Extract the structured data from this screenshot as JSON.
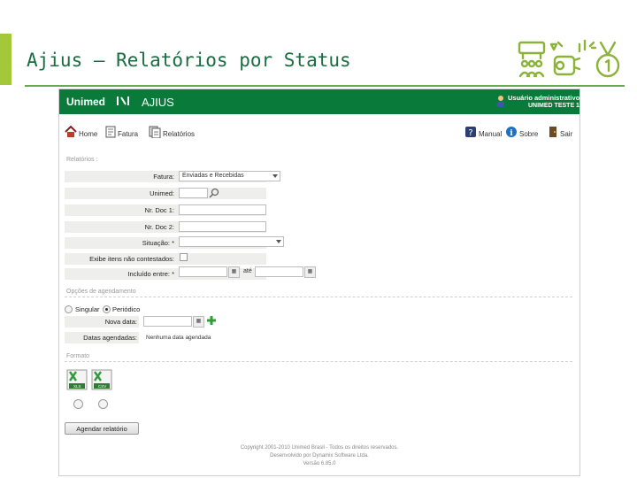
{
  "slide": {
    "title": "Ajius – Relatórios por Status"
  },
  "colors": {
    "accent": "#a3c83a",
    "header_green": "#0a7a3b",
    "title_green": "#1a6d3f"
  },
  "app": {
    "brand": "Unimed",
    "name": "AJIUS",
    "user_name": "Usuário administrativo",
    "user_unit": "UNIMED TESTE 1"
  },
  "toolbar": {
    "home": "Home",
    "fatura": "Fatura",
    "relatorios": "Relatórios",
    "manual": "Manual",
    "sobre": "Sobre",
    "sair": "Sair"
  },
  "filters": {
    "section": "Relatórios :",
    "fatura_label": "Fatura:",
    "fatura_value": "Enviadas e Recebidas",
    "unimed_label": "Unimed:",
    "nr_doc1_label": "Nr. Doc 1:",
    "nr_doc2_label": "Nr. Doc 2:",
    "situacao_label": "Situação: *",
    "exibe_label": "Exibe itens não contestados:",
    "incluido_label": "Incluído entre: *",
    "ate_label": "até"
  },
  "schedule": {
    "section": "Opções de agendamento",
    "singular": "Singular",
    "periodico": "Periódico",
    "nova_data_label": "Nova data:",
    "datas_label": "Datas agendadas:",
    "no_dates": "Nenhuma data agendada"
  },
  "format": {
    "section": "Formato",
    "xls": "XLS",
    "csv": "CSV"
  },
  "actions": {
    "agendar": "Agendar relatório"
  },
  "footer": {
    "line1": "Copyright 2001-2010 Unimed Brasil - Todos os direitos reservados.",
    "line2": "Desenvolvido por Dynamix Software Ltda.",
    "line3": "Versão 6.85.0"
  }
}
